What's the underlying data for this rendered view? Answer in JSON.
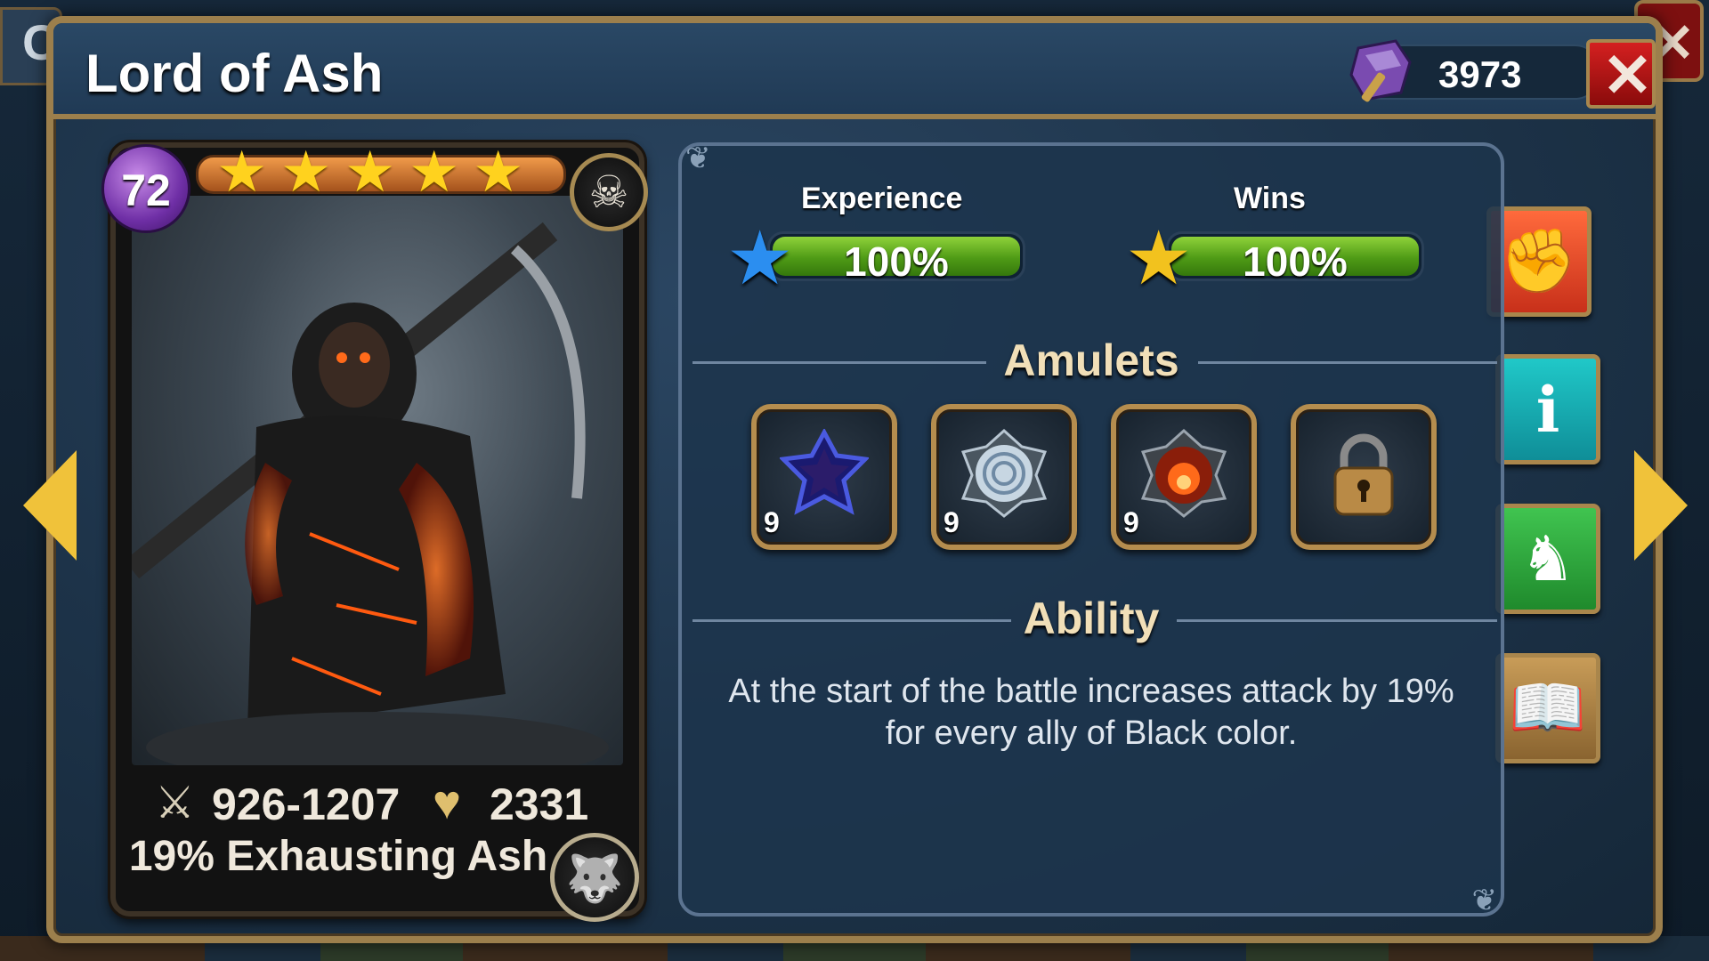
{
  "header": {
    "title": "Lord of Ash",
    "currency_value": "3973"
  },
  "hero": {
    "level": "72",
    "stars": 5,
    "attack": "926-1207",
    "health": "2331",
    "ability_short": "19% Exhausting Ash"
  },
  "progress": {
    "experience": {
      "label": "Experience",
      "value": "100%",
      "fraction": 1.0
    },
    "wins": {
      "label": "Wins",
      "value": "100%",
      "fraction": 1.0
    }
  },
  "amulets": {
    "title": "Amulets",
    "items": [
      {
        "name": "dark-blue-star-amulet",
        "level": "9",
        "locked": false
      },
      {
        "name": "silver-swirl-amulet",
        "level": "9",
        "locked": false
      },
      {
        "name": "red-fire-amulet",
        "level": "9",
        "locked": false
      },
      {
        "name": "locked-amulet-slot",
        "level": "",
        "locked": true
      }
    ]
  },
  "ability": {
    "title": "Ability",
    "description_line1": "At the start of the battle increases attack by 19%",
    "description_line2": "for every ally of Black color."
  },
  "colors": {
    "panel_border": "#9c7f4c",
    "bar_fill": "#4f9b16",
    "fight_button": "#e0482a",
    "info_button": "#17b1b1",
    "upgrade_button": "#2aa33a",
    "lore_button": "#b08a4e",
    "close_button": "#c41818"
  },
  "icons": {
    "close": "close-icon",
    "fight": "fist-icon",
    "info": "info-icon",
    "upgrade": "hero-upgrade-icon",
    "lore": "book-icon"
  }
}
